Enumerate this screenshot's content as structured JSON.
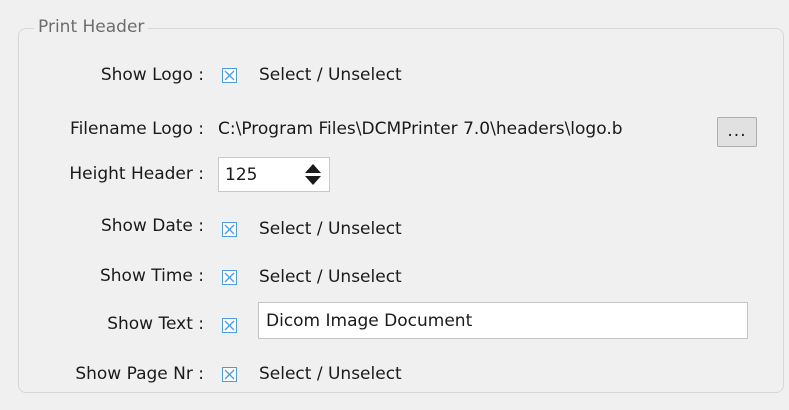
{
  "group": {
    "title": "Print Header"
  },
  "rows": {
    "show_logo": {
      "label": "Show Logo :",
      "checked": true,
      "text": "Select / Unselect"
    },
    "filename_logo": {
      "label": "Filename Logo :",
      "value": "C:\\Program Files\\DCMPrinter 7.0\\headers\\logo.b",
      "browse_label": "..."
    },
    "height_header": {
      "label": "Height Header :",
      "value": "125"
    },
    "show_date": {
      "label": "Show Date :",
      "checked": true,
      "text": "Select / Unselect"
    },
    "show_time": {
      "label": "Show Time :",
      "checked": true,
      "text": "Select / Unselect"
    },
    "show_text": {
      "label": "Show Text :",
      "checked": true,
      "value": "Dicom Image Document"
    },
    "show_page_nr": {
      "label": "Show Page Nr :",
      "checked": true,
      "text": "Select / Unselect"
    }
  },
  "colors": {
    "checkbox_border": "#4a9de0",
    "checkbox_check": "#4a9de0",
    "group_border": "#d7d7d7"
  }
}
